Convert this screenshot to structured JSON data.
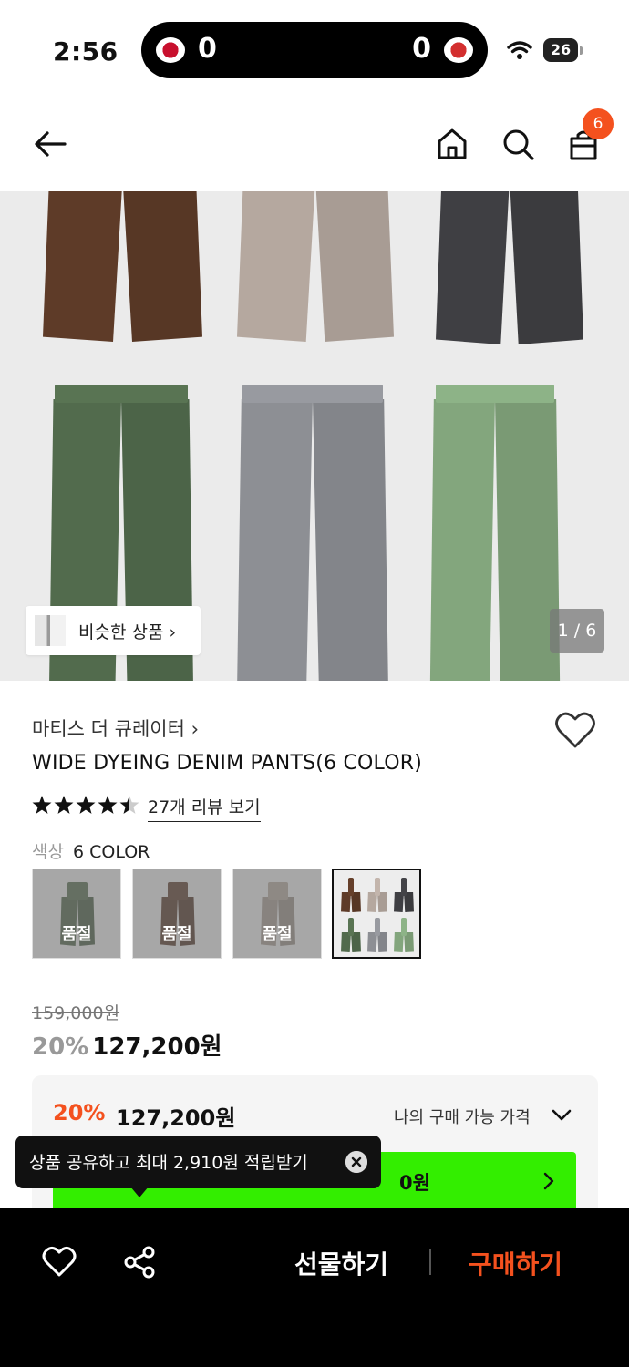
{
  "status_bar": {
    "time": "2:56",
    "score_left": "0",
    "score_right": "0",
    "battery": "26"
  },
  "header": {
    "back_icon": "arrow-left-icon",
    "home_icon": "home-icon",
    "search_icon": "search-icon",
    "cart_icon": "shopping-bag-icon",
    "cart_count": "6"
  },
  "gallery": {
    "similar_label": "비슷한 상품 ›",
    "page_indicator": "1 / 6",
    "pants_colors": [
      "#5e3b28",
      "#b5a89f",
      "#3f3f43",
      "#526b4d",
      "#8d8f94",
      "#83a67d"
    ]
  },
  "product": {
    "brand": "마티스 더 큐레이터 ›",
    "title": "WIDE DYEING DENIM PANTS(6 COLOR)",
    "rating": 4.5,
    "review_link": "27개 리뷰 보기",
    "color_key": "색상",
    "color_value": "6 COLOR",
    "swatches": [
      {
        "color": "#55694f",
        "label": "품절"
      },
      {
        "color": "#5b3e30",
        "label": "품절"
      },
      {
        "color": "#a89d95",
        "label": "품절"
      },
      {
        "color": "all",
        "label": ""
      }
    ]
  },
  "price": {
    "original": "159,000원",
    "discount_pct": "20%",
    "sale": "127,200원"
  },
  "price_box": {
    "discount_pct": "20%",
    "sale": "127,200원",
    "my_price_label": "나의 구매 가능 가격",
    "green_text": "0원"
  },
  "tooltip": {
    "text": "상품 공유하고 최대 2,910원 적립받기"
  },
  "bottom_bar": {
    "gift_label": "선물하기",
    "buy_label": "구매하기"
  },
  "colors": {
    "accent": "#f4511e",
    "promo_green": "#33ee00"
  }
}
